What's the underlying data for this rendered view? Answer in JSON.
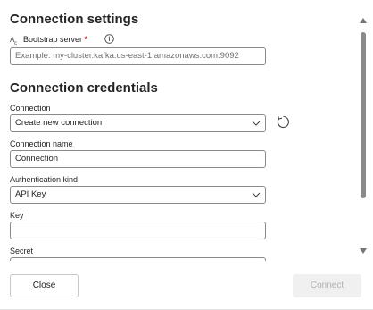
{
  "connection_settings": {
    "title": "Connection settings",
    "bootstrap_label": "Bootstrap server",
    "required_mark": "*",
    "bootstrap_placeholder": "Example: my-cluster.kafka.us-east-1.amazonaws.com:9092"
  },
  "credentials": {
    "title": "Connection credentials",
    "connection_label": "Connection",
    "connection_value": "Create new connection",
    "connection_name_label": "Connection name",
    "connection_name_value": "Connection",
    "auth_kind_label": "Authentication kind",
    "auth_kind_value": "API Key",
    "key_label": "Key",
    "key_value": "",
    "secret_label": "Secret"
  },
  "footer": {
    "close_label": "Close",
    "connect_label": "Connect"
  },
  "icons": {
    "field_type": "text-field-icon",
    "info": "info-icon",
    "refresh": "refresh-icon",
    "chevron": "chevron-down-icon"
  }
}
